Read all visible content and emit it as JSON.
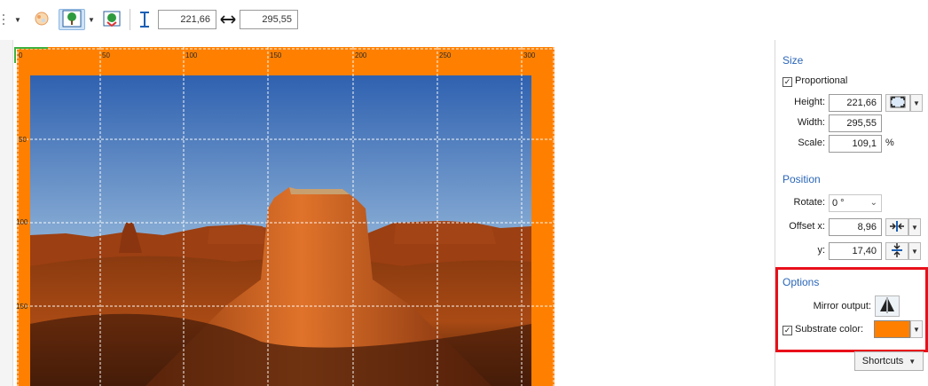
{
  "toolbar": {
    "height_value": "221,66",
    "width_value": "295,55",
    "icons": [
      "grip-icon",
      "dropdown-caret-icon",
      "paint-icon",
      "tree-fit-icon",
      "tree-crop-icon",
      "height-arrow-icon",
      "width-arrow-icon"
    ]
  },
  "canvas": {
    "ruler_top": [
      "0",
      "50",
      "100",
      "150",
      "200",
      "250",
      "300"
    ],
    "ruler_left": [
      "50",
      "100",
      "150"
    ],
    "substrate_color": "#ff8000",
    "grid_color": "#ffffff"
  },
  "panel": {
    "size": {
      "title": "Size",
      "proportional_label": "Proportional",
      "proportional_checked": true,
      "height_label": "Height:",
      "height_value": "221,66",
      "width_label": "Width:",
      "width_value": "295,55",
      "scale_label": "Scale:",
      "scale_value": "109,1",
      "scale_unit": "%"
    },
    "position": {
      "title": "Position",
      "rotate_label": "Rotate:",
      "rotate_value": "0 °",
      "offset_x_label": "Offset x:",
      "offset_x_value": "8,96",
      "offset_y_label": "y:",
      "offset_y_value": "17,40"
    },
    "options": {
      "title": "Options",
      "mirror_label": "Mirror output:",
      "substrate_label": "Substrate color:",
      "substrate_checked": true,
      "substrate_color": "#ff8000",
      "highlight_color": "#e8101a"
    },
    "shortcuts_label": "Shortcuts"
  }
}
